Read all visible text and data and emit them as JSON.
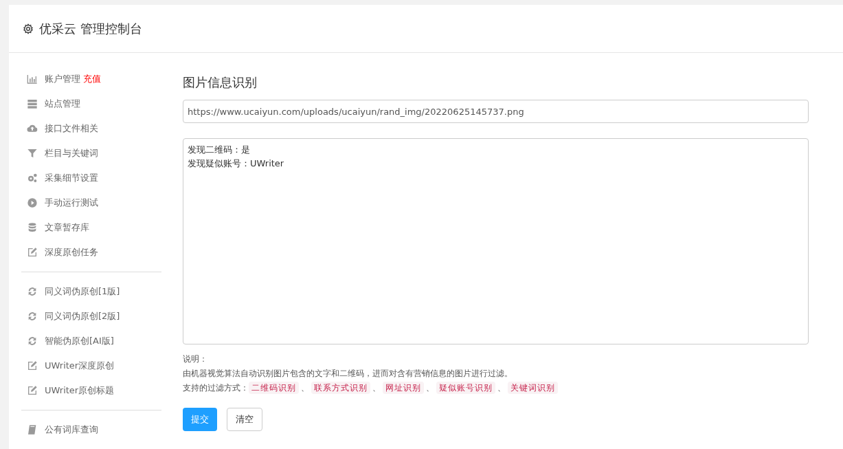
{
  "header": {
    "title": "优采云 管理控制台"
  },
  "sidebar": {
    "groups": [
      [
        {
          "kind": "chart",
          "label": "账户管理",
          "badge": "充值"
        },
        {
          "kind": "server",
          "label": "站点管理"
        },
        {
          "kind": "cloud",
          "label": "接口文件相关"
        },
        {
          "kind": "filter",
          "label": "栏目与关键词"
        },
        {
          "kind": "gears",
          "label": "采集细节设置"
        },
        {
          "kind": "play",
          "label": "手动运行测试"
        },
        {
          "kind": "database",
          "label": "文章暂存库"
        },
        {
          "kind": "edit",
          "label": "深度原创任务"
        }
      ],
      [
        {
          "kind": "refresh",
          "label": "同义词伪原创[1版]"
        },
        {
          "kind": "refresh",
          "label": "同义词伪原创[2版]"
        },
        {
          "kind": "refresh",
          "label": "智能伪原创[AI版]"
        },
        {
          "kind": "edit",
          "label": "UWriter深度原创"
        },
        {
          "kind": "edit",
          "label": "UWriter原创标题"
        }
      ],
      [
        {
          "kind": "book",
          "label": "公有词库查询"
        }
      ]
    ]
  },
  "main": {
    "title": "图片信息识别",
    "url_field": {
      "value": "https://www.ucaiyun.com/uploads/ucaiyun/rand_img/20220625145737.png"
    },
    "result_area": {
      "lines": [
        "发现二维码：是",
        "发现疑似账号：UWriter"
      ]
    },
    "notes": {
      "heading": "说明：",
      "description": "由机器视觉算法自动识别图片包含的文字和二维码，进而对含有营销信息的图片进行过滤。",
      "filters_label": "支持的过滤方式：",
      "filters": [
        {
          "label": "二维码识别",
          "separator": "、"
        },
        {
          "label": "联系方式识别",
          "separator": "、"
        },
        {
          "label": "网址识别",
          "separator": "、"
        },
        {
          "label": "疑似账号识别",
          "separator": "、"
        },
        {
          "label": "关键词识别"
        }
      ]
    },
    "buttons": [
      {
        "label": "提交",
        "kind": "primary"
      },
      {
        "label": "清空",
        "kind": "default"
      }
    ]
  }
}
